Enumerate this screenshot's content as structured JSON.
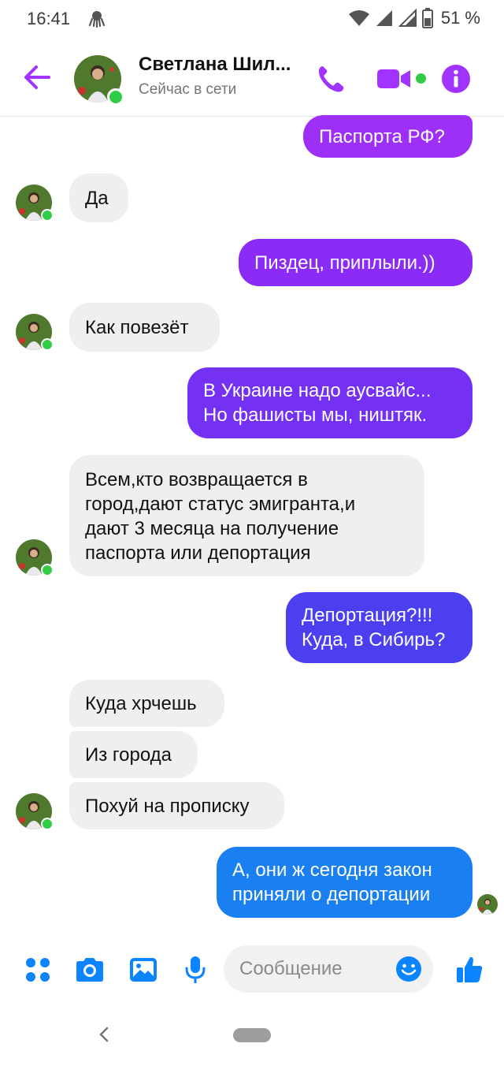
{
  "status_bar": {
    "time": "16:41",
    "battery": "51 %",
    "icons": [
      "app-notification-icon",
      "wifi-icon",
      "signal-icon",
      "signal-icon-2",
      "battery-icon"
    ]
  },
  "header": {
    "contact_name": "Светлана Шил...",
    "presence": "Сейчас в сети",
    "icons": [
      "back-arrow-icon",
      "phone-icon",
      "video-camera-icon",
      "info-icon"
    ],
    "accent_color": "#a033ff"
  },
  "messages": [
    {
      "direction": "out",
      "text": "Паспорта РФ?",
      "color": "#9d2ff7"
    },
    {
      "direction": "in",
      "text": "Да"
    },
    {
      "direction": "out",
      "text": "Пиздец, приплыли.))",
      "color": "#8b2cf6"
    },
    {
      "direction": "in",
      "text": "Как повезёт"
    },
    {
      "direction": "out",
      "lines": [
        "В Украине надо аусвайс...",
        "Но фашисты мы, ништяк."
      ],
      "color": "#7431f4"
    },
    {
      "direction": "in",
      "lines": [
        "Всем,кто возвращается в",
        "город,дают статус эмигранта,и",
        "дают 3 месяца на получение",
        "паспорта или депортация"
      ]
    },
    {
      "direction": "out",
      "lines": [
        "Депортация?!!!",
        "Куда, в Сибирь?"
      ],
      "color": "#4b3ff0"
    },
    {
      "direction": "in",
      "text": "Куда хрчешь"
    },
    {
      "direction": "in",
      "text": "Из города"
    },
    {
      "direction": "in",
      "text": "Похуй на прописку"
    },
    {
      "direction": "out",
      "lines": [
        "А, они ж сегодня закон",
        "приняли о депортации"
      ],
      "color": "#1a7ff0"
    }
  ],
  "composer": {
    "placeholder": "Сообщение",
    "icons": [
      "apps-icon",
      "camera-icon",
      "gallery-icon",
      "microphone-icon",
      "emoji-icon",
      "thumbs-up-icon"
    ],
    "icon_color": "#0a84ff"
  },
  "nav_bar": {
    "icons": [
      "nav-back-icon",
      "home-pill-icon"
    ]
  }
}
